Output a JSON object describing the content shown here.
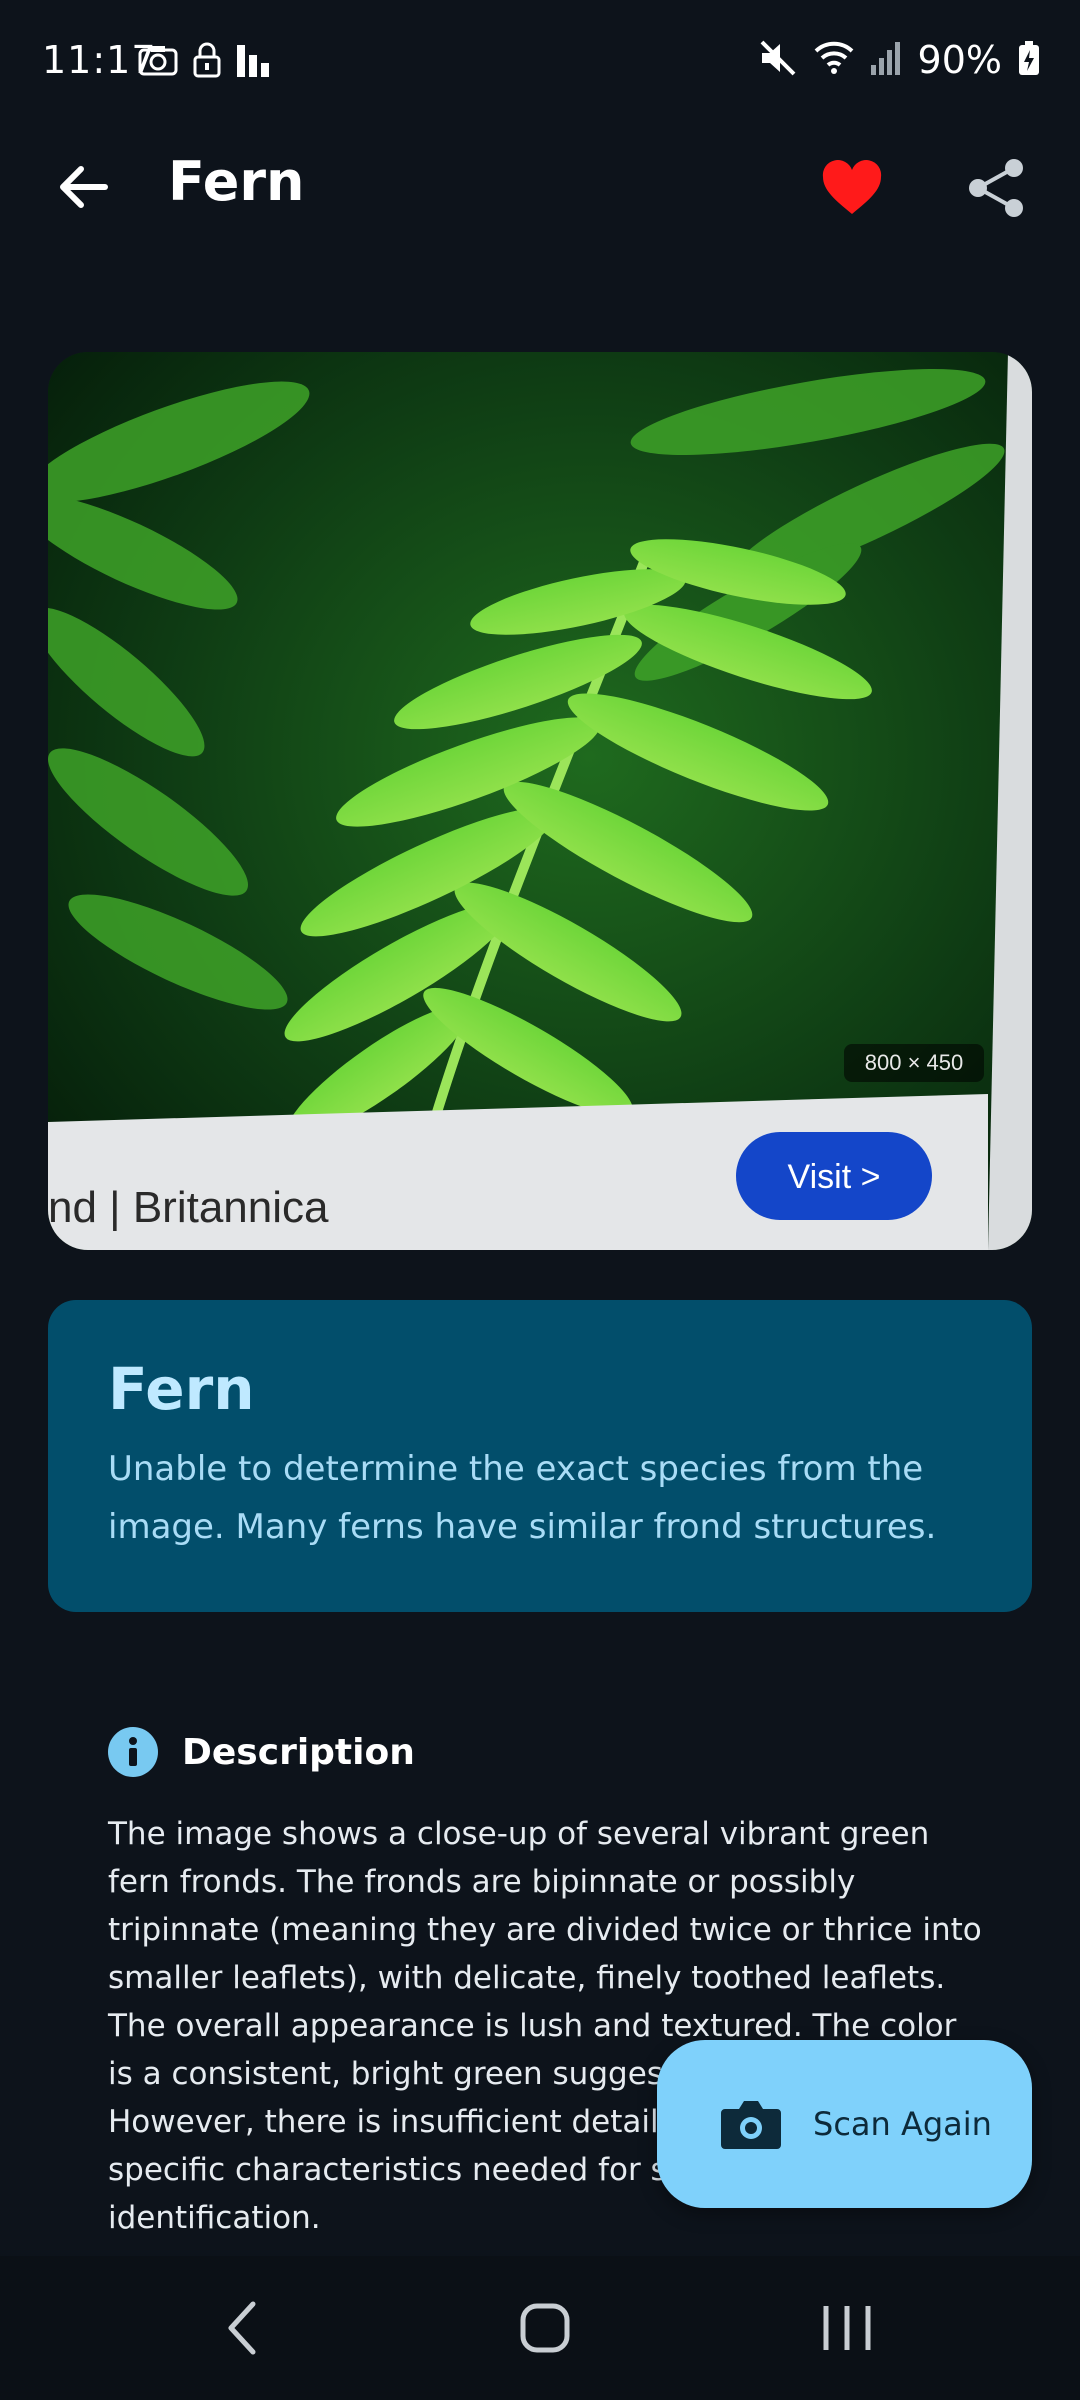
{
  "status_bar": {
    "time": "11:17",
    "battery": "90%",
    "icons": [
      "camera-icon",
      "lock-icon",
      "chart-icon",
      "mute-icon",
      "wifi-icon",
      "signal-icon",
      "battery-icon"
    ]
  },
  "app_bar": {
    "title": "Fern",
    "favorite_color": "#ff1a1a"
  },
  "photo": {
    "overlay_size": "800 × 450",
    "caption": "nd | Britannica",
    "visit_label": "Visit >"
  },
  "identification": {
    "name": "Fern",
    "note": "Unable to determine the exact species from the image.  Many ferns have similar frond structures."
  },
  "description": {
    "title": "Description",
    "text": "The image shows a close-up of several vibrant green fern fronds.  The fronds are bipinnate or possibly tripinnate (meaning they are divided twice or thrice into smaller leaflets), with delicate, finely toothed leaflets. The overall appearance is lush and textured.  The color is a consistent, bright green suggesting healthy growth. However, there is insufficient detail to determine specific characteristics needed for species identification."
  },
  "fab": {
    "label": "Scan Again"
  },
  "colors": {
    "background": "#0d131b",
    "card": "#024e6b",
    "accent": "#7fd1fb"
  }
}
